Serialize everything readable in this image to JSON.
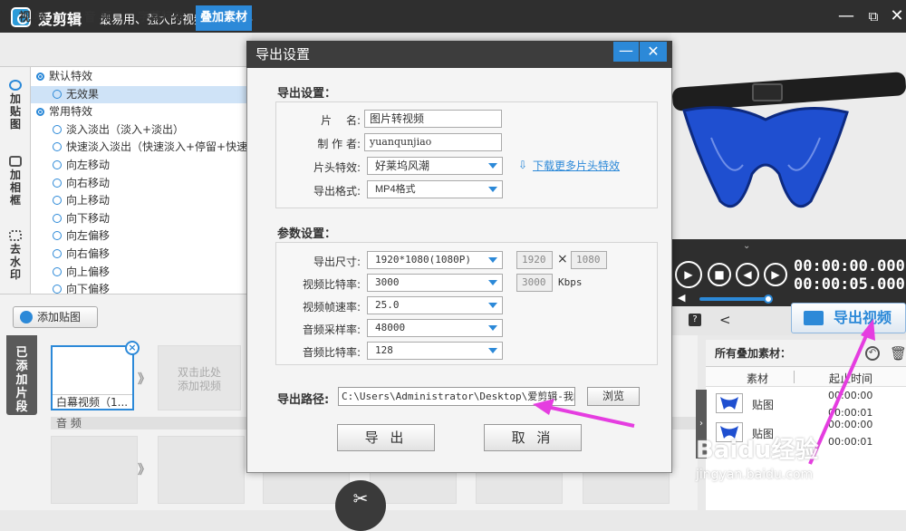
{
  "app": {
    "name": "爱剪辑",
    "slogan": "最易用、强大的视频剪辑软件"
  },
  "window_controls": {
    "minimize": "—",
    "restore": "⧉",
    "close": "✕"
  },
  "tabs": [
    {
      "label": "视 频"
    },
    {
      "label": "音 频"
    },
    {
      "label": "字幕特效"
    },
    {
      "label": "叠加素材"
    }
  ],
  "sidebar": {
    "items": [
      {
        "label": "加\n贴\n图"
      },
      {
        "label": "加\n相\n框"
      },
      {
        "label": "去\n水\n印"
      }
    ]
  },
  "effects": {
    "rows": [
      {
        "kind": "cat",
        "label": "默认特效"
      },
      {
        "kind": "item",
        "label": "无效果",
        "selected": true
      },
      {
        "kind": "cat",
        "label": "常用特效"
      },
      {
        "kind": "item",
        "label": "淡入淡出（淡入+淡出）"
      },
      {
        "kind": "item",
        "label": "快速淡入淡出（快速淡入+停留+快速淡"
      },
      {
        "kind": "item",
        "label": "向左移动"
      },
      {
        "kind": "item",
        "label": "向右移动"
      },
      {
        "kind": "item",
        "label": "向上移动"
      },
      {
        "kind": "item",
        "label": "向下移动"
      },
      {
        "kind": "item",
        "label": "向左偏移"
      },
      {
        "kind": "item",
        "label": "向右偏移"
      },
      {
        "kind": "item",
        "label": "向上偏移"
      },
      {
        "kind": "item",
        "label": "向下偏移"
      }
    ]
  },
  "add_sticker": {
    "label": "添加贴图"
  },
  "timeline": {
    "tab_label": "已\n添\n加\n片\n段",
    "clip_main_label": "白幕视频（1...",
    "clip_placeholder": "双击此处\n添加视频",
    "audio_label": "音 频",
    "next_chevron": "》"
  },
  "player": {
    "time_current": "00:00:00.000",
    "time_total": "00:00:05.000",
    "export_video_label": "导出视频"
  },
  "overlay_list": {
    "header": "所有叠加素材：",
    "col_material": "素材",
    "col_time": "起止时间",
    "items": [
      {
        "name": "贴图",
        "start": "00:00:00",
        "end": "00:00:01"
      },
      {
        "name": "贴图",
        "start": "00:00:00",
        "end": "00:00:01"
      }
    ]
  },
  "dialog": {
    "title": "导出设置",
    "min_label": "—",
    "close_label": "✕",
    "section_export": "导出设置：",
    "section_params": "参数设置：",
    "fields": {
      "film_name_label": "片　 名:",
      "film_name_value": "图片转视频",
      "author_label": "制 作 者:",
      "author_value": "yuanqunjiao",
      "intro_label": "片头特效:",
      "intro_value": "好莱坞风潮",
      "format_label": "导出格式:",
      "format_value": "MP4格式",
      "download_more": "下载更多片头特效",
      "size_label": "导出尺寸:",
      "size_value": "1920*1080(1080P)",
      "width_value": "1920",
      "height_value": "1080",
      "size_times": "×",
      "vbitrate_label": "视频比特率:",
      "vbitrate_value": "3000",
      "vbitrate_custom": "3000",
      "kbps": "Kbps",
      "fps_label": "视频帧速率:",
      "fps_value": "25.0",
      "samplerate_label": "音频采样率:",
      "samplerate_value": "48000",
      "abitrate_label": "音频比特率:",
      "abitrate_value": "128",
      "path_label": "导出路径:",
      "path_value": "C:\\Users\\Administrator\\Desktop\\爱剪辑-我的视",
      "browse": "浏览"
    },
    "export_button": "导 出",
    "cancel_button": "取 消"
  },
  "watermark": {
    "text": "Baidu经验",
    "sub": "jingyan.baidu.com"
  },
  "colors": {
    "accent": "#2c89d8",
    "titlebar": "#2f2f2f",
    "annotation": "#e53de0"
  }
}
